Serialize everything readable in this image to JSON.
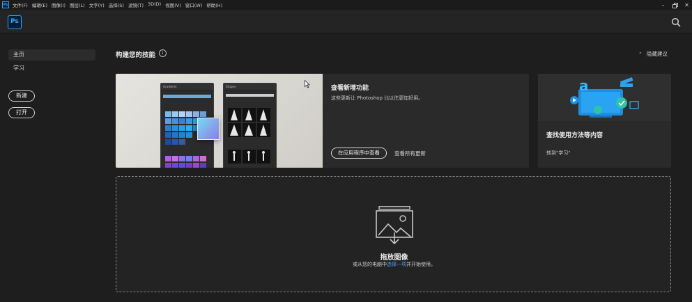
{
  "menubar": {
    "app_icon": "Ps",
    "items": [
      "文件(F)",
      "编辑(E)",
      "图像(I)",
      "图层(L)",
      "文字(Y)",
      "选择(S)",
      "滤镜(T)",
      "3D(D)",
      "视图(V)",
      "窗口(W)",
      "帮助(H)"
    ],
    "window_controls": [
      "minimize-icon",
      "restore-icon",
      "close-icon"
    ]
  },
  "header": {
    "logo": "Ps",
    "search_icon": "search-icon"
  },
  "sidebar": {
    "items": [
      {
        "label": "主页",
        "active": true
      },
      {
        "label": "学习",
        "active": false
      }
    ],
    "new_button": "新建",
    "open_button": "打开"
  },
  "main": {
    "section_title": "构建您的技能",
    "hide_tips": "隐藏建议",
    "news_card": {
      "title": "查看新增功能",
      "description": "这些更新让 Photoshop 比以往更加好用。",
      "primary_button": "在应用程序中查看",
      "secondary_link": "查看所有更新",
      "panel_gradients": "Gradients",
      "panel_shapes": "Shapes"
    },
    "learn_card": {
      "title": "查找使用方法等内容",
      "link": "转到\"学习\""
    },
    "dropzone": {
      "title": "拖放图像",
      "subtitle_prefix": "或从您的电脑中",
      "subtitle_link": "选择一项",
      "subtitle_suffix": "并开始使用。"
    }
  },
  "colors": {
    "accent": "#31a8ff",
    "background": "#1e1e1e",
    "card": "#2a2a2a",
    "link": "#4aa0ff"
  }
}
